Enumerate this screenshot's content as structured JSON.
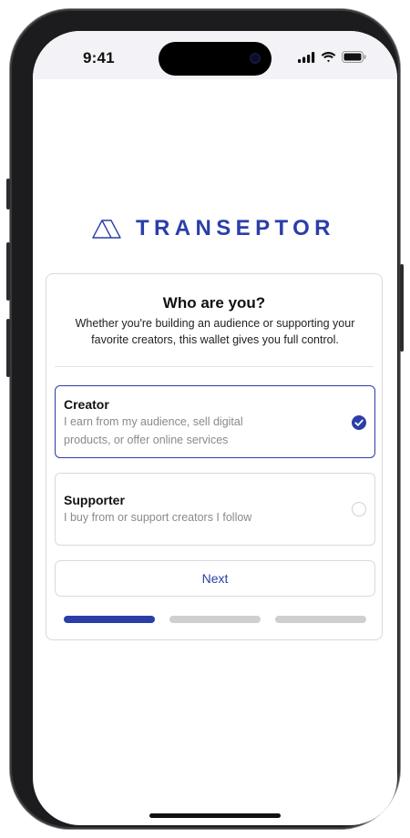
{
  "status_bar": {
    "time": "9:41",
    "icons": [
      "cellular-signal-icon",
      "wifi-icon",
      "battery-icon"
    ]
  },
  "brand": {
    "logo_icon": "triangle-logo-icon",
    "name": "TRANSEPTOR",
    "color": "#2b3ea7"
  },
  "card": {
    "title": "Who are you?",
    "subtitle": "Whether you're building an audience or supporting your favorite creators, this wallet gives you full control.",
    "options": [
      {
        "title": "Creator",
        "description": "I earn from my audience, sell digital products, or offer online services",
        "selected": true
      },
      {
        "title": "Supporter",
        "description": "I buy from or support creators I follow",
        "selected": false
      }
    ],
    "next_label": "Next",
    "progress": {
      "current_step": 1,
      "total_steps": 3
    }
  }
}
